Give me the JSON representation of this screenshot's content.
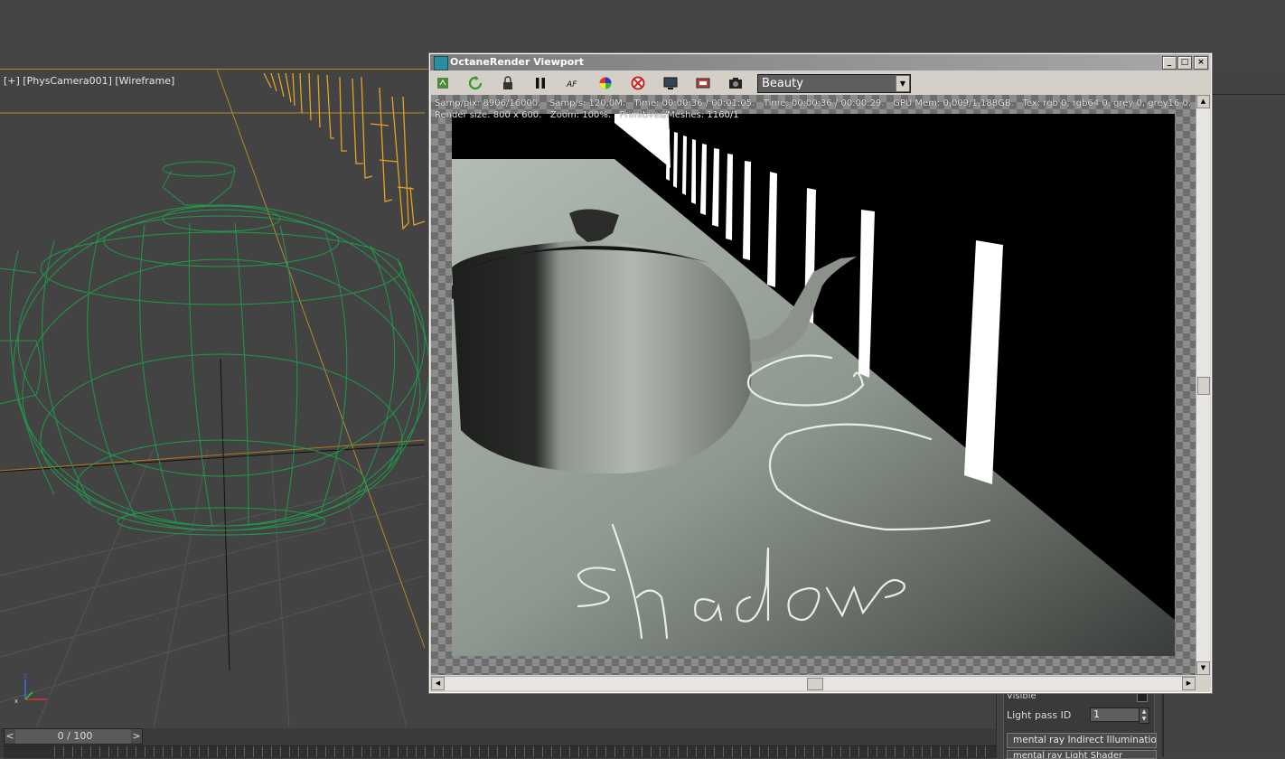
{
  "viewport": {
    "label": "[+] [PhysCamera001] [Wireframe]",
    "time_slider": {
      "value": "0 / 100",
      "prev": "<",
      "next": ">"
    }
  },
  "octane": {
    "title": "OctaneRender Viewport",
    "pass": "Beauty",
    "stats_line1": "Samp/pix: 8906/16000.   Samp/s: 120,0M.   Time: 00:00:36 / 00:01:05.   Time: 00:00:36 / 00:00:29.   GPU Mem: 0,009/1,188GB.   Tex: rgb 0, rgb64 0, grey 0, grey16 0.",
    "stats_line2": "Render size: 800 x 600.   Zoom: 100%.   Primitives/Meshes: 1160/1",
    "annotation": "shadow",
    "window_buttons": {
      "minimize": "_",
      "maximize": "□",
      "close": "×"
    }
  },
  "command_panel": {
    "visible_label": "Visible",
    "light_pass_label": "Light pass ID",
    "light_pass_value": "1",
    "rollouts": [
      "mental ray Indirect Illumination",
      "mental ray Light Shader"
    ]
  },
  "colors": {
    "wireframe": "#1f9a4a",
    "lights_wireframe": "#e5a31f",
    "viewport_bg": "#434343",
    "window_chrome": "#d4d0c8"
  }
}
